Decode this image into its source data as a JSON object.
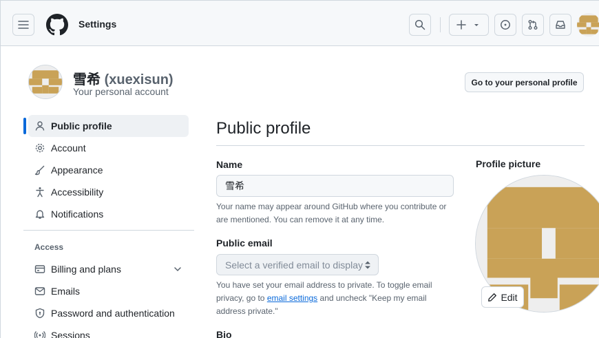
{
  "header": {
    "title": "Settings"
  },
  "account": {
    "display_name": "雪希",
    "login": "(xuexisun)",
    "subtitle": "Your personal account",
    "profile_button": "Go to your personal profile"
  },
  "sidebar": {
    "items": [
      {
        "label": "Public profile",
        "icon": "person-icon",
        "active": true
      },
      {
        "label": "Account",
        "icon": "gear-icon"
      },
      {
        "label": "Appearance",
        "icon": "paintbrush-icon"
      },
      {
        "label": "Accessibility",
        "icon": "accessibility-icon"
      },
      {
        "label": "Notifications",
        "icon": "bell-icon"
      }
    ],
    "access_heading": "Access",
    "access_items": [
      {
        "label": "Billing and plans",
        "icon": "credit-card-icon"
      },
      {
        "label": "Emails",
        "icon": "mail-icon"
      },
      {
        "label": "Password and authentication",
        "icon": "shield-lock-icon"
      },
      {
        "label": "Sessions",
        "icon": "broadcast-icon"
      }
    ]
  },
  "main": {
    "title": "Public profile",
    "name_label": "Name",
    "name_value": "雪希",
    "name_help": "Your name may appear around GitHub where you contribute or are mentioned. You can remove it at any time.",
    "email_label": "Public email",
    "email_placeholder": "Select a verified email to display",
    "email_help_before": "You have set your email address to private. To toggle email privacy, go to ",
    "email_help_link": "email settings",
    "email_help_after": " and uncheck \"Keep my email address private.\"",
    "bio_label": "Bio"
  },
  "picture": {
    "label": "Profile picture",
    "edit_label": "Edit"
  },
  "colors": {
    "accent": "#0969da",
    "avatar": "#c9a257"
  }
}
